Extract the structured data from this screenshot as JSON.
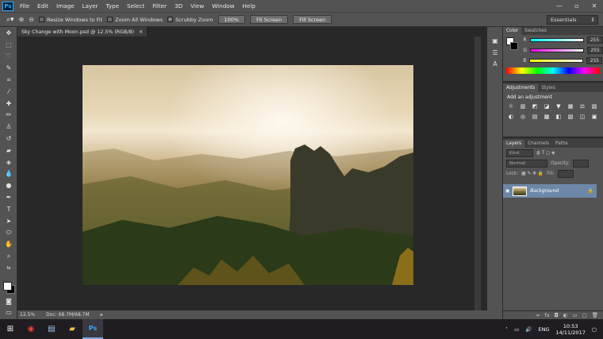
{
  "app": {
    "logo": "Ps"
  },
  "menu": [
    "File",
    "Edit",
    "Image",
    "Layer",
    "Type",
    "Select",
    "Filter",
    "3D",
    "View",
    "Window",
    "Help"
  ],
  "options": {
    "checks": [
      {
        "label": "Resize Windows to Fit",
        "checked": false
      },
      {
        "label": "Zoom All Windows",
        "checked": false
      },
      {
        "label": "Scrubby Zoom",
        "checked": true
      }
    ],
    "buttons": [
      "100%",
      "Fit Screen",
      "Fill Screen"
    ],
    "workspace": "Essentials"
  },
  "document": {
    "tab_title": "Sky Change with Moon.psd @ 12.5% (RGB/8)",
    "tab_close": "×",
    "zoom": "12.5%",
    "doc_size": "Doc: 68.7M/68.7M"
  },
  "color_panel": {
    "tabs": [
      "Color",
      "Swatches"
    ],
    "channels": [
      {
        "name": "R",
        "value": "255",
        "gradient": "#ff0000"
      },
      {
        "name": "G",
        "value": "255",
        "gradient": "#ff00ff"
      },
      {
        "name": "B",
        "value": "255",
        "gradient": "#ffff00"
      }
    ]
  },
  "adjustments_panel": {
    "tabs": [
      "Adjustments",
      "Styles"
    ],
    "title": "Add an adjustment",
    "icons": [
      "☼",
      "▥",
      "◩",
      "◪",
      "▼",
      "▦",
      "⚖",
      "▧",
      "◐",
      "◎",
      "▤",
      "▩",
      "◧",
      "▨",
      "◫",
      "▣"
    ]
  },
  "layers_panel": {
    "tabs": [
      "Layers",
      "Channels",
      "Paths"
    ],
    "kind": "Kind",
    "blend": "Normal",
    "opacity_label": "Opacity:",
    "lock_label": "Lock:",
    "fill_label": "Fill:",
    "layer_name": "Background"
  },
  "taskbar": {
    "language": "ENG",
    "time": "10:53",
    "date": "14/11/2017"
  }
}
